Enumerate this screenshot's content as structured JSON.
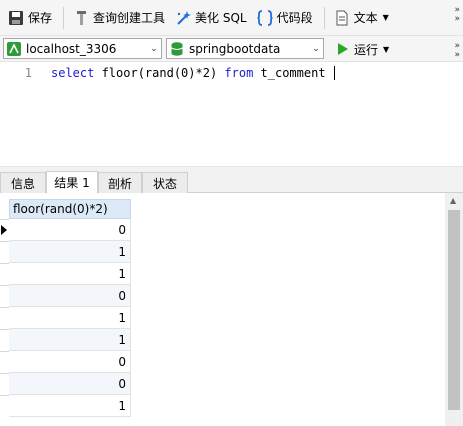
{
  "toolbar": {
    "save_label": "保存",
    "query_builder_label": "查询创建工具",
    "beautify_sql_label": "美化 SQL",
    "code_snippet_label": "代码段",
    "text_label": "文本"
  },
  "connection_bar": {
    "connection": "localhost_3306",
    "database": "springbootdata",
    "run_label": "运行"
  },
  "editor": {
    "line_number": "1",
    "tokens": {
      "select": "select",
      "expr": " floor(rand(0)*2) ",
      "from": "from",
      "table": " t_comment "
    }
  },
  "result_tabs": [
    {
      "label": "信息"
    },
    {
      "label": "结果 1",
      "active": true
    },
    {
      "label": "剖析"
    },
    {
      "label": "状态"
    }
  ],
  "result_grid": {
    "column_header": "floor(rand(0)*2)",
    "rows": [
      "0",
      "1",
      "1",
      "0",
      "1",
      "1",
      "0",
      "0",
      "1"
    ],
    "selected_row": 0
  },
  "colors": {
    "keyword": "#1c1cd4",
    "header_bg": "#dce9f7",
    "run_green": "#2aa82a",
    "beautify_blue": "#1e6fd8"
  },
  "icons": {
    "save": "save-icon",
    "query_builder": "query-builder-icon",
    "beautify": "magic-wand-icon",
    "code_snippet": "braces-icon",
    "text": "document-icon",
    "connection": "server-connection-icon",
    "database": "database-icon",
    "run": "play-icon"
  }
}
